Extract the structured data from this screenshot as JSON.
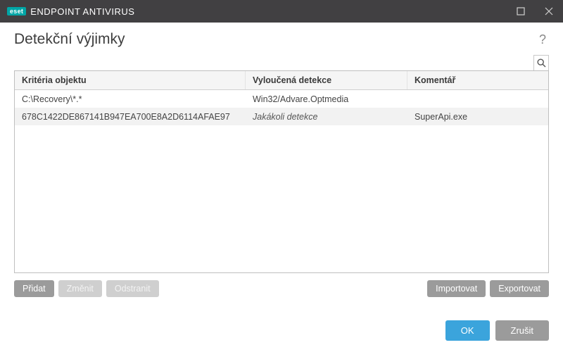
{
  "titlebar": {
    "badge": "eset",
    "product": "ENDPOINT ANTIVIRUS"
  },
  "page": {
    "title": "Detekční výjimky",
    "help_tooltip": "?"
  },
  "table": {
    "columns": {
      "criteria": "Kritéria objektu",
      "excluded": "Vyloučená detekce",
      "comment": "Komentář"
    },
    "rows": [
      {
        "criteria": "C:\\Recovery\\*.*",
        "excluded": "Win32/Advare.Optmedia",
        "excluded_italic": false,
        "comment": ""
      },
      {
        "criteria": "678C1422DE867141B947EA700E8A2D6114AFAE97",
        "excluded": "Jakákoli detekce",
        "excluded_italic": true,
        "comment": "SuperApi.exe"
      }
    ]
  },
  "buttons": {
    "add": "Přidat",
    "edit": "Změnit",
    "remove": "Odstranit",
    "import": "Importovat",
    "export": "Exportovat",
    "ok": "OK",
    "cancel": "Zrušit"
  }
}
